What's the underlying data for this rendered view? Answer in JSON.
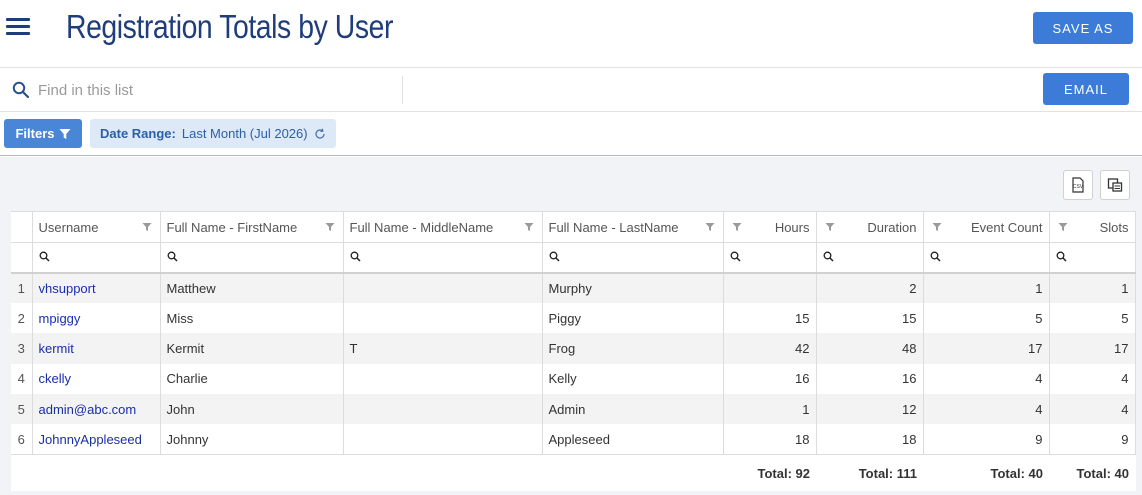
{
  "header": {
    "title": "Registration Totals by User",
    "save_label": "SAVE AS"
  },
  "search": {
    "placeholder": "Find in this list",
    "email_label": "EMAIL"
  },
  "filters": {
    "button_label": "Filters",
    "chip_key": "Date Range:",
    "chip_value": "Last Month (Jul 2026)"
  },
  "columns": [
    "Username",
    "Full Name - FirstName",
    "Full Name - MiddleName",
    "Full Name - LastName",
    "Hours",
    "Duration",
    "Event Count",
    "Slots"
  ],
  "rows": [
    {
      "num": "1",
      "username": "vhsupport",
      "first": "Matthew",
      "middle": "",
      "last": "Murphy",
      "hours": "",
      "duration": "2",
      "events": "1",
      "slots": "1"
    },
    {
      "num": "2",
      "username": "mpiggy",
      "first": "Miss",
      "middle": "",
      "last": "Piggy",
      "hours": "15",
      "duration": "15",
      "events": "5",
      "slots": "5"
    },
    {
      "num": "3",
      "username": "kermit",
      "first": "Kermit",
      "middle": "T",
      "last": "Frog",
      "hours": "42",
      "duration": "48",
      "events": "17",
      "slots": "17"
    },
    {
      "num": "4",
      "username": "ckelly",
      "first": "Charlie",
      "middle": "",
      "last": "Kelly",
      "hours": "16",
      "duration": "16",
      "events": "4",
      "slots": "4"
    },
    {
      "num": "5",
      "username": "admin@abc.com",
      "first": "John",
      "middle": "",
      "last": "Admin",
      "hours": "1",
      "duration": "12",
      "events": "4",
      "slots": "4"
    },
    {
      "num": "6",
      "username": "JohnnyAppleseed",
      "first": "Johnny",
      "middle": "",
      "last": "Appleseed",
      "hours": "18",
      "duration": "18",
      "events": "9",
      "slots": "9"
    }
  ],
  "totals": {
    "hours": "Total: 92",
    "duration": "Total: 111",
    "events": "Total: 40",
    "slots": "Total: 40"
  },
  "colors": {
    "accent": "#3d7bd9",
    "title": "#1f3d7a",
    "link": "#1a2ea8"
  }
}
